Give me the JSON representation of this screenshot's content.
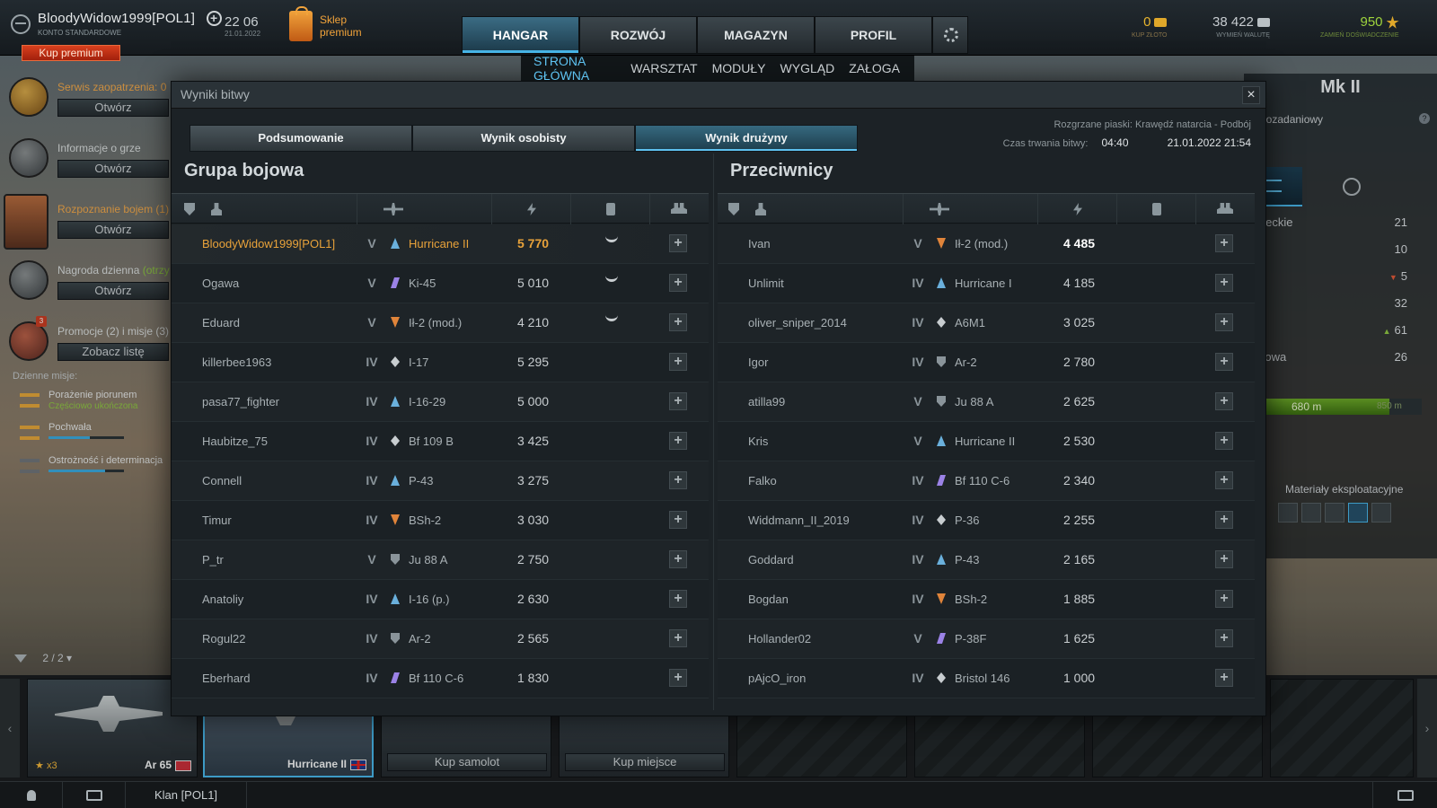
{
  "topbar": {
    "username": "BloodyWidow1999[POL1]",
    "account_type": "KONTO STANDARDOWE",
    "buy_premium": "Kup premium",
    "time": "22 06",
    "date": "21.01.2022",
    "shop_label": "Sklep premium",
    "nav_tabs": [
      "HANGAR",
      "ROZWÓJ",
      "MAGAZYN",
      "PROFIL"
    ],
    "sub_nav": [
      "STRONA GŁÓWNA",
      "WARSZTAT",
      "MODUŁY",
      "WYGLĄD",
      "ZAŁOGA"
    ],
    "currency": {
      "gold_value": "0",
      "gold_label": "KUP ZŁOTO",
      "silver_value": "38 422",
      "silver_label": "WYMIEŃ WALUTĘ",
      "exp_value": "950",
      "exp_label": "ZAMIEŃ DOŚWIADCZENIE"
    }
  },
  "sidebar": {
    "items": [
      {
        "title": "Serwis zaopatrzenia:",
        "count": "0",
        "button": "Otwórz"
      },
      {
        "title": "Informacje o grze",
        "button": "Otwórz"
      },
      {
        "title": "Rozpoznanie bojem (1)",
        "button": "Otwórz"
      },
      {
        "title": "Nagroda dzienna",
        "status": "(otrzy",
        "button": "Otwórz"
      },
      {
        "title": "Promocje (2) i misje (3)",
        "badge": "3",
        "button": "Zobacz listę"
      }
    ],
    "missions_label": "Dzienne misje:",
    "missions": [
      {
        "name": "Porażenie piorunem",
        "sub": "Częściowo ukończona"
      },
      {
        "name": "Pochwała",
        "progress": 0.55
      },
      {
        "name": "Ostrożność i determinacja",
        "progress": 0.75
      }
    ]
  },
  "right_panel": {
    "title": "Mk II",
    "subtitle": "iozadaniowy",
    "help": "?",
    "stats": [
      {
        "label": "eleckie",
        "value": "21"
      },
      {
        "label": "",
        "value": "10"
      },
      {
        "label": "",
        "value": "5",
        "trend": "down"
      },
      {
        "label": "",
        "value": "32"
      },
      {
        "label": "",
        "value": "61",
        "trend": "up"
      },
      {
        "label": "ciowa",
        "value": "26"
      }
    ],
    "bar_now": "680 m",
    "bar_max": "850 m",
    "bar_fraction": 0.8,
    "materials_label": "Materiały eksploatacyjne"
  },
  "carousel": {
    "filter_count": "2 / 2",
    "cards": [
      {
        "name": "Ar 65",
        "count": "x3"
      },
      {
        "name": "Hurricane II"
      }
    ],
    "buy_plane": "Kup samolot",
    "buy_slot": "Kup miejsce"
  },
  "footer": {
    "clan": "Klan [POL1]"
  },
  "modal": {
    "title": "Wyniki bitwy",
    "close": "×",
    "tabs": [
      "Podsumowanie",
      "Wynik osobisty",
      "Wynik drużyny"
    ],
    "mode_line": "Rozgrzane piaski: Krawędź natarcia - Podbój",
    "duration_label": "Czas trwania bitwy:",
    "duration": "04:40",
    "datetime": "21.01.2022 21:54",
    "team_title": "Grupa bojowa",
    "enemy_title": "Przeciwnicy",
    "team": [
      {
        "name": "BloodyWidow1999[POL1]",
        "tier": "V",
        "type": "fighter",
        "plane": "Hurricane II",
        "score": "5 770",
        "medal": true,
        "add": "+"
      },
      {
        "name": "Ogawa",
        "tier": "V",
        "type": "multi",
        "plane": "Ki-45",
        "score": "5 010",
        "medal": true,
        "add": "+"
      },
      {
        "name": "Eduard",
        "tier": "V",
        "type": "attack",
        "plane": "Ił-2 (mod.)",
        "score": "4 210",
        "medal": true,
        "add": "+"
      },
      {
        "name": "killerbee1963",
        "tier": "IV",
        "type": "heavy",
        "plane": "I-17",
        "score": "5 295",
        "add": "+"
      },
      {
        "name": "pasa77_fighter",
        "tier": "IV",
        "type": "fighter",
        "plane": "I-16-29",
        "score": "5 000",
        "add": "+"
      },
      {
        "name": "Haubitze_75",
        "tier": "IV",
        "type": "heavy",
        "plane": "Bf 109 B",
        "score": "3 425",
        "add": "+"
      },
      {
        "name": "Connell",
        "tier": "IV",
        "type": "fighter",
        "plane": "P-43",
        "score": "3 275",
        "add": "+"
      },
      {
        "name": "Timur",
        "tier": "IV",
        "type": "attack",
        "plane": "BSh-2",
        "score": "3 030",
        "add": "+"
      },
      {
        "name": "P_tr",
        "tier": "V",
        "type": "bomber",
        "plane": "Ju 88 A",
        "score": "2 750",
        "add": "+"
      },
      {
        "name": "Anatoliy",
        "tier": "IV",
        "type": "fighter",
        "plane": "I-16 (p.)",
        "score": "2 630",
        "add": "+"
      },
      {
        "name": "Rogul22",
        "tier": "IV",
        "type": "bomber",
        "plane": "Ar-2",
        "score": "2 565",
        "add": "+"
      },
      {
        "name": "Eberhard",
        "tier": "IV",
        "type": "multi",
        "plane": "Bf 110 C-6",
        "score": "1 830",
        "add": "+"
      }
    ],
    "enemies": [
      {
        "name": "Ivan",
        "tier": "V",
        "type": "attack",
        "plane": "Ił-2 (mod.)",
        "score": "4 485",
        "add": "+"
      },
      {
        "name": "Unlimit",
        "tier": "IV",
        "type": "fighter",
        "plane": "Hurricane I",
        "score": "4 185",
        "add": "+"
      },
      {
        "name": "oliver_sniper_2014",
        "tier": "IV",
        "type": "heavy",
        "plane": "A6M1",
        "score": "3 025",
        "add": "+"
      },
      {
        "name": "Igor",
        "tier": "IV",
        "type": "bomber",
        "plane": "Ar-2",
        "score": "2 780",
        "add": "+"
      },
      {
        "name": "atilla99",
        "tier": "V",
        "type": "bomber",
        "plane": "Ju 88 A",
        "score": "2 625",
        "add": "+"
      },
      {
        "name": "Kris",
        "tier": "V",
        "type": "fighter",
        "plane": "Hurricane II",
        "score": "2 530",
        "add": "+"
      },
      {
        "name": "Falko",
        "tier": "IV",
        "type": "multi",
        "plane": "Bf 110 C-6",
        "score": "2 340",
        "add": "+"
      },
      {
        "name": "Widdmann_II_2019",
        "tier": "IV",
        "type": "heavy",
        "plane": "P-36",
        "score": "2 255",
        "add": "+"
      },
      {
        "name": "Goddard",
        "tier": "IV",
        "type": "fighter",
        "plane": "P-43",
        "score": "2 165",
        "add": "+"
      },
      {
        "name": "Bogdan",
        "tier": "IV",
        "type": "attack",
        "plane": "BSh-2",
        "score": "1 885",
        "add": "+"
      },
      {
        "name": "Hollander02",
        "tier": "V",
        "type": "multi",
        "plane": "P-38F",
        "score": "1 625",
        "add": "+"
      },
      {
        "name": "pAjcO_iron",
        "tier": "IV",
        "type": "heavy",
        "plane": "Bristol 146",
        "score": "1 000",
        "add": "+"
      }
    ]
  }
}
